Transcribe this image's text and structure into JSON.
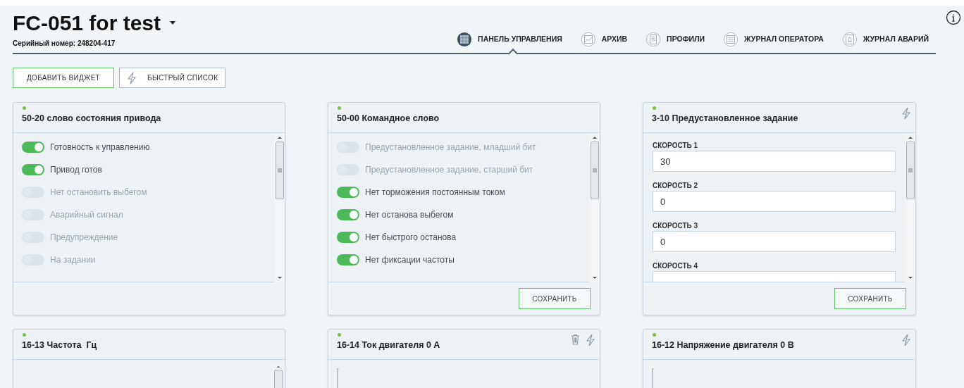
{
  "header": {
    "title": "FC-051 for test",
    "serial": "Серийный номер: 248204-417"
  },
  "tabs": [
    {
      "label": "ПАНЕЛЬ УПРАВЛЕНИЯ",
      "selected": true
    },
    {
      "label": "АРХИВ",
      "selected": false
    },
    {
      "label": "ПРОФИЛИ",
      "selected": false
    },
    {
      "label": "ЖУРНАЛ ОПЕРАТОРА",
      "selected": false
    },
    {
      "label": "ЖУРНАЛ АВАРИЙ",
      "selected": false
    }
  ],
  "toolbar": [
    {
      "label": "ДОБАВИТЬ ВИДЖЕТ",
      "kind": "primary"
    },
    {
      "label": "БЫСТРЫЙ СПИСОК",
      "kind": "quick"
    }
  ],
  "widgets": [
    {
      "title": "50-20 слово состояния привода",
      "online": true,
      "kind": "toggles",
      "items": [
        {
          "label": "Готовность к управлению",
          "on": true
        },
        {
          "label": "Привод готов",
          "on": true
        },
        {
          "label": "Нет остановить выбегом",
          "on": false
        },
        {
          "label": "Аварийный сигнал",
          "on": false
        },
        {
          "label": "Предупреждение",
          "on": false
        },
        {
          "label": "На задании",
          "on": false
        }
      ]
    },
    {
      "title": "50-00 Командное слово",
      "online": true,
      "kind": "toggles",
      "save": "СОХРАНИТЬ",
      "items": [
        {
          "label": "Предустановленное задание, младший бит",
          "on": false
        },
        {
          "label": "Предустановленное задание, старший бит",
          "on": false
        },
        {
          "label": "Нет торможения постоянным током",
          "on": true
        },
        {
          "label": "Нет останова выбегом",
          "on": true
        },
        {
          "label": "Нет быстрого останова",
          "on": true
        },
        {
          "label": "Нет фиксации частоты",
          "on": true
        }
      ]
    },
    {
      "title": "3-10 Предустановленное задание",
      "online": true,
      "kind": "fields",
      "actions": [
        {
          "kind": "quick"
        }
      ],
      "save": "СОХРАНИТЬ",
      "fields": [
        {
          "label": "СКОРОСТЬ 1",
          "value": "30"
        },
        {
          "label": "СКОРОСТЬ 2",
          "value": "0"
        },
        {
          "label": "СКОРОСТЬ 3",
          "value": "0"
        },
        {
          "label": "СКОРОСТЬ 4"
        }
      ]
    },
    {
      "title": "16-13 Частота  Гц",
      "online": true,
      "kind": "list"
    },
    {
      "title": "16-14 Ток двигателя 0 А",
      "online": true,
      "kind": "graph",
      "actions": [
        {
          "kind": "delete"
        },
        {
          "kind": "quick"
        }
      ]
    },
    {
      "title": "16-12 Напряжение двигателя 0 В",
      "online": true,
      "kind": "graph",
      "actions": [
        {
          "kind": "quick"
        }
      ]
    }
  ]
}
